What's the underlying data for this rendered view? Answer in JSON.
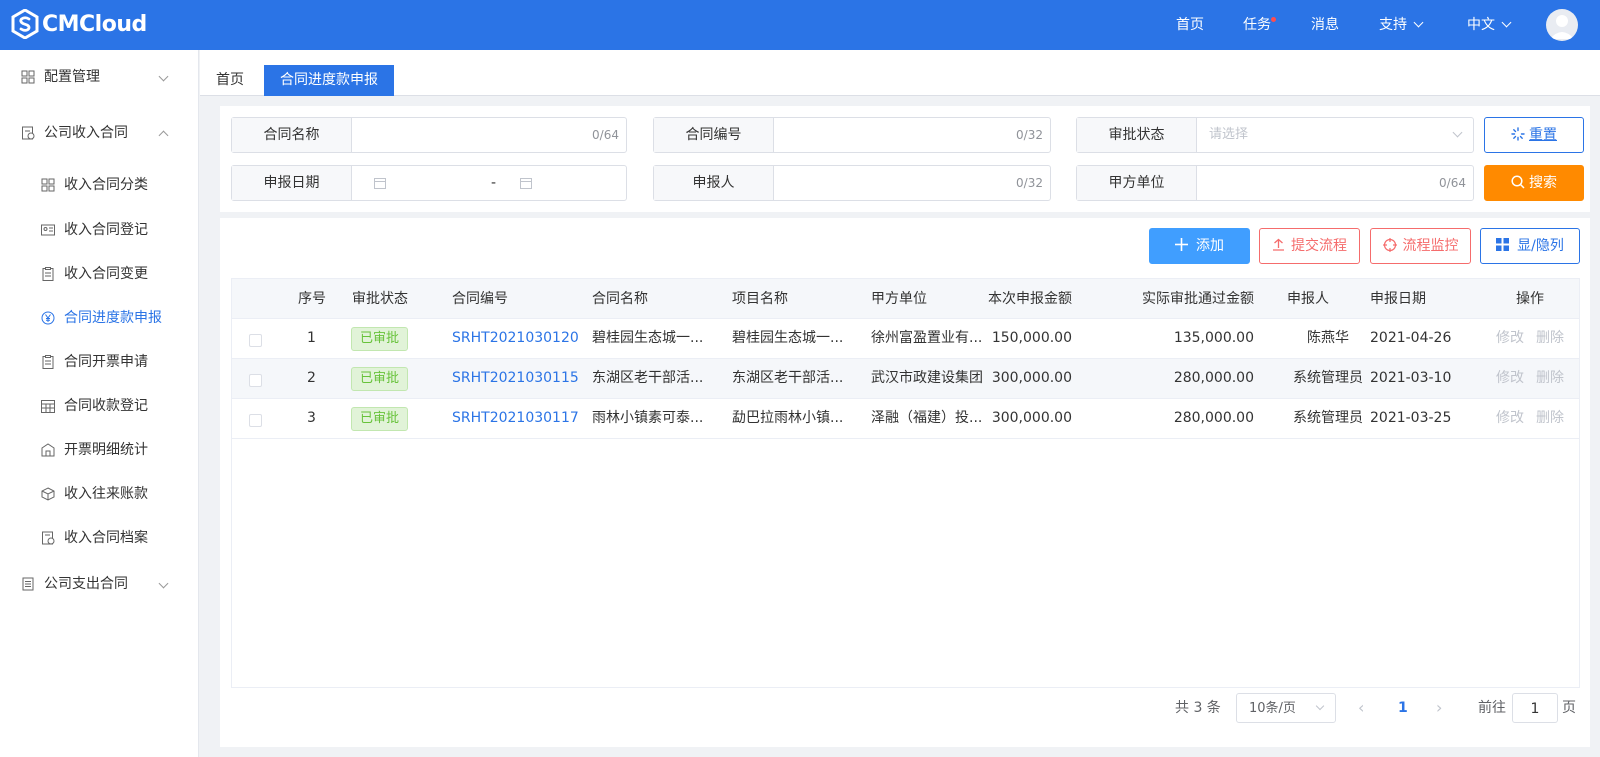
{
  "header": {
    "brand": "CMCloud",
    "nav": {
      "home": "首页",
      "tasks": "任务",
      "messages": "消息",
      "support": "支持",
      "language": "中文"
    }
  },
  "sidebar": {
    "groups": [
      {
        "label": "配置管理",
        "icon": "grid-icon"
      },
      {
        "label": "公司收入合同",
        "icon": "contract-icon"
      },
      {
        "label": "公司支出合同",
        "icon": "document-icon"
      }
    ],
    "items": [
      {
        "label": "收入合同分类",
        "icon": "grid-icon"
      },
      {
        "label": "收入合同登记",
        "icon": "id-card-icon"
      },
      {
        "label": "收入合同变更",
        "icon": "clipboard-icon"
      },
      {
        "label": "合同进度款申报",
        "icon": "yen-icon"
      },
      {
        "label": "合同开票申请",
        "icon": "clipboard-icon"
      },
      {
        "label": "合同收款登记",
        "icon": "calendar-icon"
      },
      {
        "label": "开票明细统计",
        "icon": "building-icon"
      },
      {
        "label": "收入往来账款",
        "icon": "cube-icon"
      },
      {
        "label": "收入合同档案",
        "icon": "archive-icon"
      }
    ]
  },
  "tabs": {
    "home": "首页",
    "current": "合同进度款申报"
  },
  "filters": {
    "contract_name": {
      "label": "合同名称",
      "counter": "0/64"
    },
    "contract_no": {
      "label": "合同编号",
      "counter": "0/32"
    },
    "approval_status": {
      "label": "审批状态",
      "placeholder": "请选择"
    },
    "report_date": {
      "label": "申报日期",
      "separator": "-"
    },
    "reporter": {
      "label": "申报人",
      "counter": "0/32"
    },
    "party_a": {
      "label": "甲方单位",
      "counter": "0/64"
    },
    "reset_label": "重置",
    "search_label": "搜索"
  },
  "toolbar": {
    "add": "添加",
    "submit_flow": "提交流程",
    "monitor_flow": "流程监控",
    "toggle_columns": "显/隐列"
  },
  "table": {
    "columns": [
      "序号",
      "审批状态",
      "合同编号",
      "合同名称",
      "项目名称",
      "甲方单位",
      "本次申报金额",
      "实际审批通过金额",
      "申报人",
      "申报日期",
      "操作"
    ],
    "rows": [
      {
        "no": "1",
        "status": "已审批",
        "code": "SRHT2021030120",
        "name": "碧桂园生态城一...",
        "project": "碧桂园生态城一...",
        "party": "徐州富盈置业有...",
        "amount": "150,000.00",
        "approved": "135,000.00",
        "reporter": "陈燕华",
        "date": "2021-04-26",
        "edit": "修改",
        "delete": "删除"
      },
      {
        "no": "2",
        "status": "已审批",
        "code": "SRHT2021030115",
        "name": "东湖区老干部活...",
        "project": "东湖区老干部活...",
        "party": "武汉市政建设集团",
        "amount": "300,000.00",
        "approved": "280,000.00",
        "reporter": "系统管理员",
        "date": "2021-03-10",
        "edit": "修改",
        "delete": "删除"
      },
      {
        "no": "3",
        "status": "已审批",
        "code": "SRHT2021030117",
        "name": "雨林小镇素可泰...",
        "project": "勐巴拉雨林小镇...",
        "party": "泽融（福建）投...",
        "amount": "300,000.00",
        "approved": "280,000.00",
        "reporter": "系统管理员",
        "date": "2021-03-25",
        "edit": "修改",
        "delete": "删除"
      }
    ]
  },
  "pagination": {
    "total": "共 3 条",
    "page_size": "10条/页",
    "current_page": "1",
    "goto_label": "前往",
    "goto_value": "1",
    "page_suffix": "页"
  },
  "colors": {
    "primary": "#2b74e6",
    "orange": "#ff8a00",
    "danger": "#f56c6c",
    "success": "#67c23a"
  }
}
